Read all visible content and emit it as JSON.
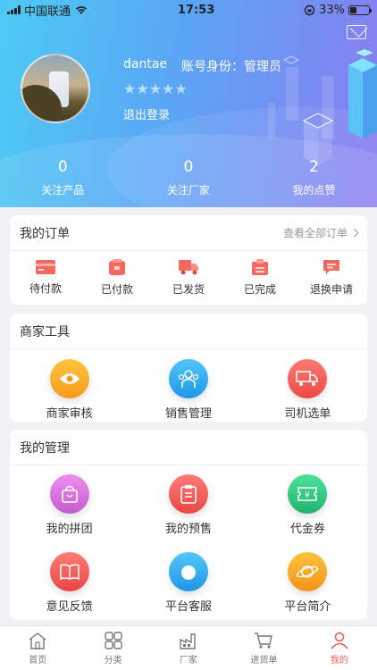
{
  "status_bar": {
    "carrier": "中国联通",
    "time": "17:53",
    "battery": "33%",
    "battery_level": 0.33
  },
  "profile": {
    "username": "dantae",
    "role": "账号身份：管理员",
    "stars": "★★★★★",
    "logout": "退出登录"
  },
  "stats": [
    {
      "value": "0",
      "label": "关注产品"
    },
    {
      "value": "0",
      "label": "关注厂家"
    },
    {
      "value": "2",
      "label": "我的点赞"
    }
  ],
  "orders": {
    "title": "我的订单",
    "view_all": "查看全部订单",
    "items": [
      {
        "label": "待付款",
        "icon": "card-icon"
      },
      {
        "label": "已付款",
        "icon": "wallet-icon"
      },
      {
        "label": "已发货",
        "icon": "truck-icon"
      },
      {
        "label": "已完成",
        "icon": "box-icon"
      },
      {
        "label": "退换申请",
        "icon": "chat-icon"
      }
    ]
  },
  "merchant_tools": {
    "title": "商家工具",
    "items": [
      {
        "label": "商家审核",
        "icon": "eye-icon",
        "color": "#f8a51e"
      },
      {
        "label": "销售管理",
        "icon": "team-icon",
        "color": "#29a9ee"
      },
      {
        "label": "司机选单",
        "icon": "truck-icon",
        "color": "#f25a5a"
      }
    ]
  },
  "management": {
    "title": "我的管理",
    "items": [
      {
        "label": "我的拼团",
        "icon": "bag-icon",
        "color": "#d36bd4"
      },
      {
        "label": "我的预售",
        "icon": "clipboard-icon",
        "color": "#f05656"
      },
      {
        "label": "代金券",
        "icon": "coupon-icon",
        "color": "#2cc47e"
      },
      {
        "label": "意见反馈",
        "icon": "book-icon",
        "color": "#f05656"
      },
      {
        "label": "平台客服",
        "icon": "headset-icon",
        "color": "#2aa7ee"
      },
      {
        "label": "平台简介",
        "icon": "planet-icon",
        "color": "#f6a321"
      }
    ]
  },
  "tabbar": [
    {
      "label": "首页",
      "icon": "home-icon",
      "active": false
    },
    {
      "label": "分类",
      "icon": "grid-icon",
      "active": false
    },
    {
      "label": "厂家",
      "icon": "factory-icon",
      "active": false
    },
    {
      "label": "进货单",
      "icon": "cart-icon",
      "active": false
    },
    {
      "label": "我的",
      "icon": "user-icon",
      "active": true
    }
  ]
}
